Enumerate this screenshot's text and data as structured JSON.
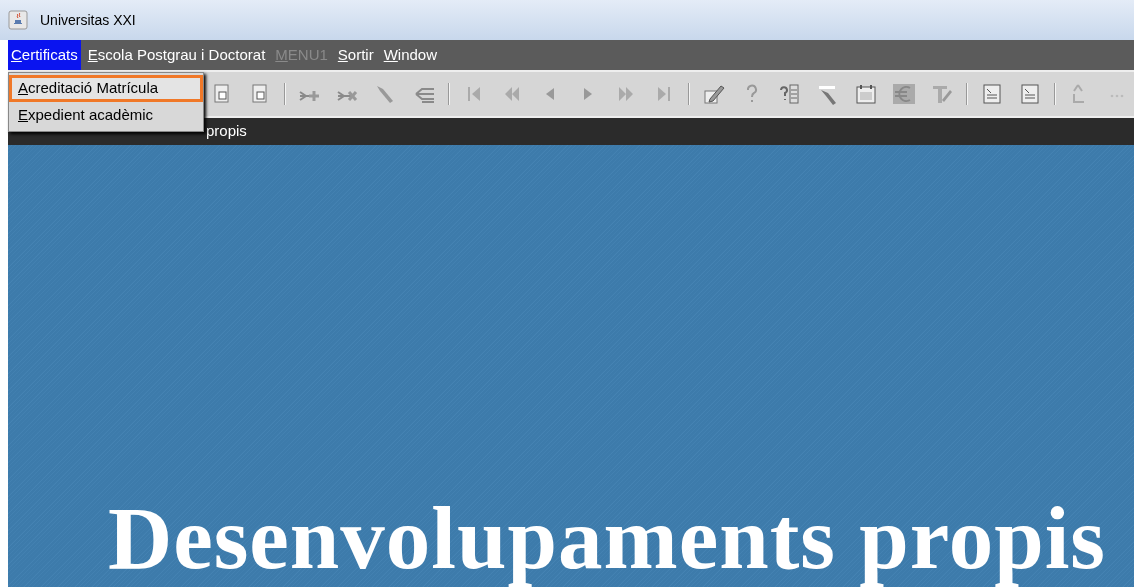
{
  "window": {
    "title": "Universitas XXI"
  },
  "menu_bar": [
    {
      "label": "Certificats",
      "selected": true,
      "disabled": false
    },
    {
      "label": "Escola Postgrau i Doctorat",
      "selected": false,
      "disabled": false
    },
    {
      "label": "MENU1",
      "selected": false,
      "disabled": true
    },
    {
      "label": "Sortir",
      "selected": false,
      "disabled": false
    },
    {
      "label": "Window",
      "selected": false,
      "disabled": false
    }
  ],
  "dropdown": [
    {
      "label": "Acreditació Matrícula",
      "selected": true
    },
    {
      "label": "Expedient acadèmic",
      "selected": false
    }
  ],
  "form_title": "propis",
  "banner": "Desenvolupaments propis"
}
